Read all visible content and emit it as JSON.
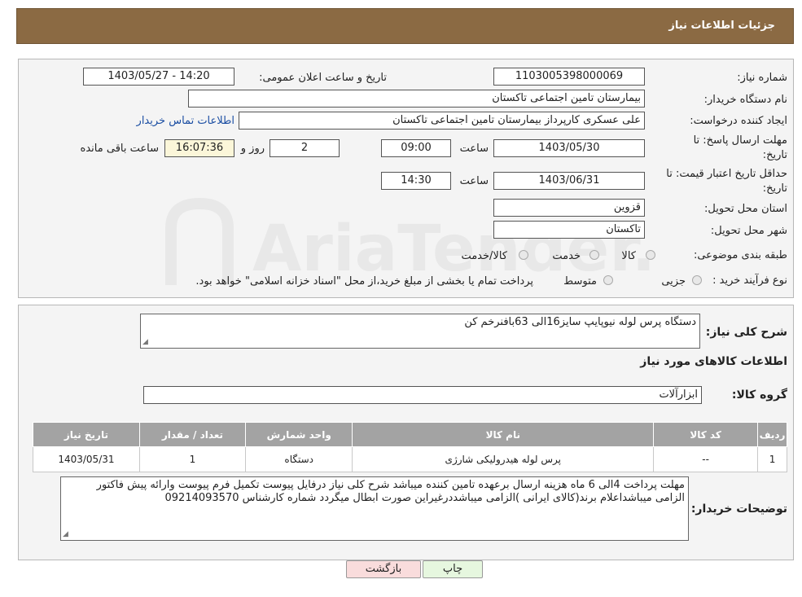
{
  "header": {
    "title": "جزئیات اطلاعات نیاز"
  },
  "form": {
    "need_number_label": "شماره نیاز:",
    "need_number_value": "1103005398000069",
    "announce_label": "تاریخ و ساعت اعلان عمومی:",
    "announce_value": "1403/05/27 - 14:20",
    "buyer_org_label": "نام دستگاه خریدار:",
    "buyer_org_value": "بیمارستان تامین اجتماعی تاکستان",
    "requester_label": "ایجاد کننده درخواست:",
    "requester_value": "علی عسکری کارپرداز بیمارستان تامین اجتماعی تاکستان",
    "contact_link": "اطلاعات تماس خریدار",
    "reply_deadline_label_1": "مهلت ارسال پاسخ: تا",
    "reply_deadline_label_2": "تاریخ:",
    "reply_date": "1403/05/30",
    "time_label": "ساعت",
    "reply_time": "09:00",
    "days_value": "2",
    "days_label": "روز و",
    "remaining_time": "16:07:36",
    "remaining_label": "ساعت باقی مانده",
    "price_valid_label_1": "حداقل تاریخ اعتبار قیمت: تا",
    "price_valid_label_2": "تاریخ:",
    "price_valid_date": "1403/06/31",
    "price_valid_time": "14:30",
    "province_label": "استان محل تحویل:",
    "province_value": "قزوین",
    "city_label": "شهر محل تحویل:",
    "city_value": "تاکستان",
    "category_label": "طبقه بندی موضوعی:",
    "category_options": [
      "کالا",
      "خدمت",
      "کالا/خدمت"
    ],
    "process_label": "نوع فرآیند خرید :",
    "process_options": [
      "جزیی",
      "متوسط"
    ],
    "process_note": "پرداخت تمام یا بخشی از مبلغ خرید،از محل \"اسناد خزانه اسلامی\" خواهد بود."
  },
  "summary": {
    "desc_label": "شرح کلی نیاز:",
    "desc_value": "دستگاه پرس لوله نیوپایپ سایز16الی 63بافنرخم کن",
    "goods_info_title": "اطلاعات کالاهای مورد نیاز",
    "group_label": "گروه کالا:",
    "group_value": "ابزارآلات"
  },
  "table": {
    "headers": [
      "ردیف",
      "کد کالا",
      "نام کالا",
      "واحد شمارش",
      "تعداد / مقدار",
      "تاریخ نیاز"
    ],
    "rows": [
      [
        "1",
        "--",
        "پرس لوله هیدرولیکی شارژی",
        "دستگاه",
        "1",
        "1403/05/31"
      ]
    ]
  },
  "buyer_notes": {
    "label": "توضیحات خریدار:",
    "text": "مهلت پرداخت 4الی 6 ماه هزینه ارسال برعهده تامین کننده میباشد شرح کلی نیاز درفایل پیوست تکمیل فرم پیوست وارائه پیش فاکتور الزامی میباشداعلام برند(کالای ایرانی )الزامی میباشددرغیراین صورت ابطال میگردد شماره کارشناس 09214093570"
  },
  "buttons": {
    "print": "چاپ",
    "back": "بازگشت"
  },
  "watermark": {
    "text": "AriaTender.neT"
  },
  "colors": {
    "header_bg": "#8b6a43",
    "table_header_bg": "#a3a3a3",
    "link": "#1b4ea3",
    "back_button_bg": "#f9dcdc",
    "print_button_bg": "#e6f7df"
  }
}
